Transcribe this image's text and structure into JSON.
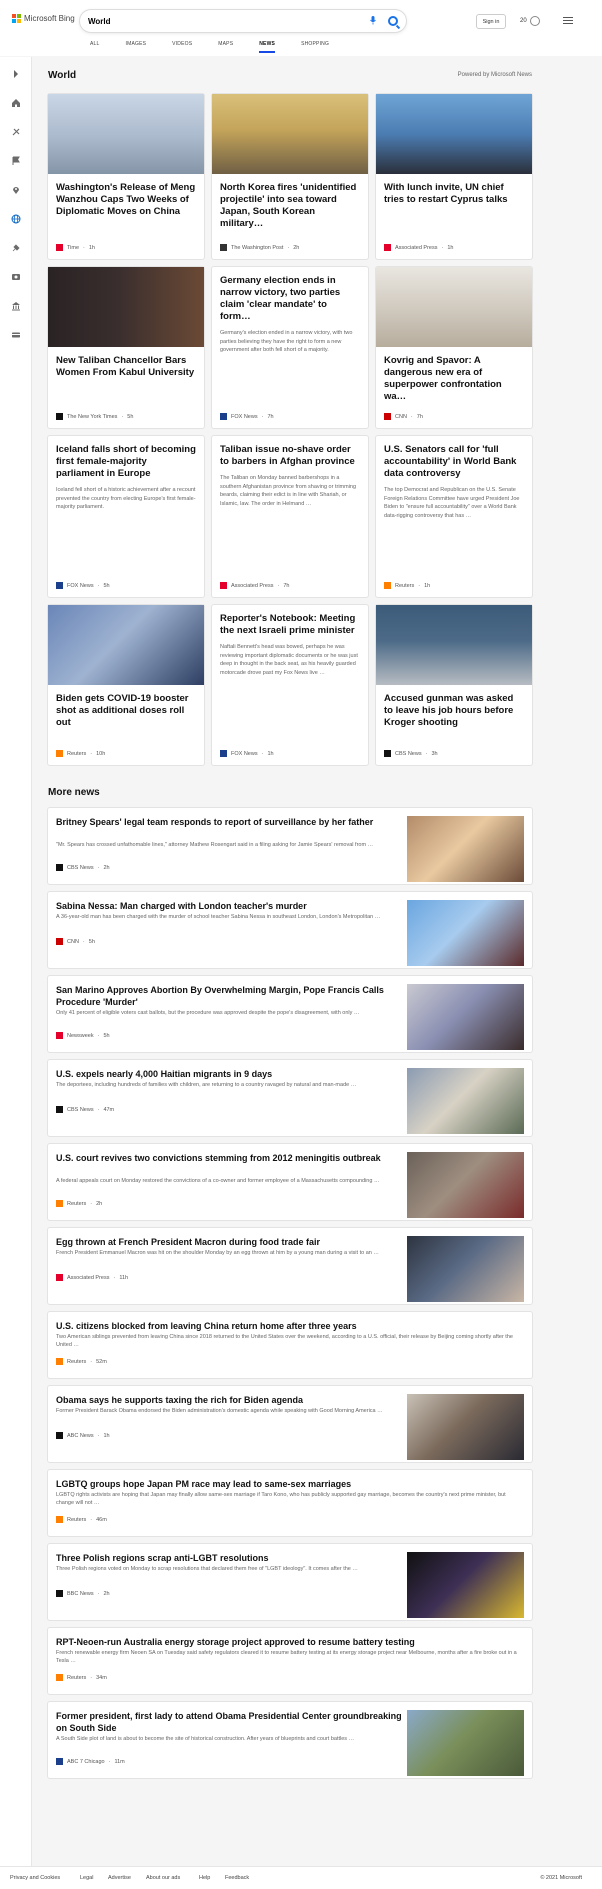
{
  "header": {
    "brand": "Microsoft Bing",
    "search_value": "World",
    "signin": "Sign in",
    "rewards_count": "20"
  },
  "tabs": [
    "ALL",
    "IMAGES",
    "VIDEOS",
    "MAPS",
    "NEWS",
    "SHOPPING"
  ],
  "active_tab": "NEWS",
  "section": {
    "title": "World",
    "powered": "Powered by Microsoft News"
  },
  "cards": [
    {
      "title": "Washington's Release of Meng Wanzhou Caps Two Weeks of Diplomatic Moves on China",
      "snippet": "",
      "source": "Time",
      "age": "1h",
      "logo_color": "#e4002b"
    },
    {
      "title": "North Korea fires 'unidentified projectile' into sea toward Japan, South Korean military…",
      "snippet": "",
      "source": "The Washington Post",
      "age": "2h",
      "logo_color": "#333333"
    },
    {
      "title": "With lunch invite, UN chief tries to restart Cyprus talks",
      "snippet": "",
      "source": "Associated Press",
      "age": "1h",
      "logo_color": "#e4002b"
    },
    {
      "title": "New Taliban Chancellor Bars Women From Kabul University",
      "snippet": "",
      "source": "The New York Times",
      "age": "5h",
      "logo_color": "#111111"
    },
    {
      "title": "Germany election ends in narrow victory, two parties claim 'clear mandate' to form…",
      "snippet": "Germany's election ended in a narrow victory, with two parties believing they have the right to form a new government after both fell short of a majority.",
      "source": "FOX News",
      "age": "7h",
      "logo_color": "#1b3f8b"
    },
    {
      "title": "Kovrig and Spavor: A dangerous new era of superpower confrontation wa…",
      "snippet": "",
      "source": "CNN",
      "age": "7h",
      "logo_color": "#cc0000"
    },
    {
      "title": "Iceland falls short of becoming first female-majority parliament in Europe",
      "snippet": "Iceland fell short of a historic achievement after a recount prevented the country from electing Europe's first female-majority parliament.",
      "source": "FOX News",
      "age": "5h",
      "logo_color": "#1b3f8b"
    },
    {
      "title": "Taliban issue no-shave order to barbers in Afghan province",
      "snippet": "The Taliban on Monday banned barbershops in a southern Afghanistan province from shaving or trimming beards, claiming their edict is in line with Shariah, or Islamic, law. The order in Helmand …",
      "source": "Associated Press",
      "age": "7h",
      "logo_color": "#e4002b"
    },
    {
      "title": "U.S. Senators call for 'full accountability' in World Bank data controversy",
      "snippet": "The top Democrat and Republican on the U.S. Senate Foreign Relations Committee have urged President Joe Biden to \"ensure full accountability\" over a World Bank data-rigging controversy that has …",
      "source": "Reuters",
      "age": "1h",
      "logo_color": "#ff8000"
    },
    {
      "title": "Biden gets COVID-19 booster shot as additional doses roll out",
      "snippet": "",
      "source": "Reuters",
      "age": "10h",
      "logo_color": "#ff8000"
    },
    {
      "title": "Reporter's Notebook: Meeting the next Israeli prime minister",
      "snippet": "Naftali Bennett's head was bowed, perhaps he was reviewing important diplomatic documents or he was just deep in thought in the back seat, as his heavily guarded motorcade drove past my Fox News live …",
      "source": "FOX News",
      "age": "1h",
      "logo_color": "#1b3f8b"
    },
    {
      "title": "Accused gunman was asked to leave his job hours before Kroger shooting",
      "snippet": "",
      "source": "CBS News",
      "age": "3h",
      "logo_color": "#111111"
    }
  ],
  "more_news_title": "More news",
  "more_news": [
    {
      "title": "Britney Spears' legal team responds to report of surveillance by her father",
      "snippet": "\"Mr. Spears has crossed unfathomable lines,\" attorney Mathew Rosengart said in a filing asking for Jamie Spears' removal from …",
      "source": "CBS News",
      "age": "2h",
      "logo_color": "#111111"
    },
    {
      "title": "Sabina Nessa: Man charged with London teacher's murder",
      "snippet": "A 36-year-old man has been charged with the murder of school teacher Sabina Nessa in southeast London, London's Metropolitan …",
      "source": "CNN",
      "age": "5h",
      "logo_color": "#cc0000"
    },
    {
      "title": "San Marino Approves Abortion By Overwhelming Margin, Pope Francis Calls Procedure 'Murder'",
      "snippet": "Only 41 percent of eligible voters cast ballots, but the procedure was approved despite the pope's disagreement, with only …",
      "source": "Newsweek",
      "age": "5h",
      "logo_color": "#e4002b"
    },
    {
      "title": "U.S. expels nearly 4,000 Haitian migrants in 9 days",
      "snippet": "The deportees, including hundreds of families with children, are returning to a country ravaged by natural and man-made …",
      "source": "CBS News",
      "age": "47m",
      "logo_color": "#111111"
    },
    {
      "title": "U.S. court revives two convictions stemming from 2012 meningitis outbreak",
      "snippet": "A federal appeals court on Monday restored the convictions of a co-owner and former employee of a Massachusetts compounding …",
      "source": "Reuters",
      "age": "2h",
      "logo_color": "#ff8000"
    },
    {
      "title": "Egg thrown at French President Macron during food trade fair",
      "snippet": "French President Emmanuel Macron was hit on the shoulder Monday by an egg thrown at him by a young man during a visit to an …",
      "source": "Associated Press",
      "age": "11h",
      "logo_color": "#e4002b"
    },
    {
      "title": "U.S. citizens blocked from leaving China return home after three years",
      "snippet": "Two American siblings prevented from leaving China since 2018 returned to the United States over the weekend, according to a U.S. official, their release by Beijing coming shortly after the United …",
      "source": "Reuters",
      "age": "52m",
      "logo_color": "#ff8000"
    },
    {
      "title": "Obama says he supports taxing the rich for Biden agenda",
      "snippet": "Former President Barack Obama endorsed the Biden administration's domestic agenda while speaking with Good Morning America …",
      "source": "ABC News",
      "age": "1h",
      "logo_color": "#111111"
    },
    {
      "title": "LGBTQ groups hope Japan PM race may lead to same-sex marriages",
      "snippet": "LGBTQ rights activists are hoping that Japan may finally allow same-sex marriage if Taro Kono, who has publicly supported gay marriage, becomes the country's next prime minister, but change will not …",
      "source": "Reuters",
      "age": "46m",
      "logo_color": "#ff8000"
    },
    {
      "title": "Three Polish regions scrap anti-LGBT resolutions",
      "snippet": "Three Polish regions voted on Monday to scrap resolutions that declared them free of \"LGBT ideology\". It comes after the …",
      "source": "BBC News",
      "age": "2h",
      "logo_color": "#111111"
    },
    {
      "title": "RPT-Neoen-run Australia energy storage project approved to resume battery testing",
      "snippet": "French renewable energy firm Neoen SA on Tuesday said safety regulators cleared it to resume battery testing at its energy storage project near Melbourne, months after a fire broke out in a Tesla …",
      "source": "Reuters",
      "age": "34m",
      "logo_color": "#ff8000"
    },
    {
      "title": "Former president, first lady to attend Obama Presidential Center groundbreaking on South Side",
      "snippet": "A South Side plot of land is about to become the site of historical construction. After years of blueprints and court battles …",
      "source": "ABC 7 Chicago",
      "age": "11m",
      "logo_color": "#1b3f8b"
    }
  ],
  "footer": {
    "links": [
      "Privacy and Cookies",
      "Legal",
      "Advertise",
      "About our ads",
      "Help",
      "Feedback"
    ],
    "copyright": "© 2021 Microsoft"
  }
}
